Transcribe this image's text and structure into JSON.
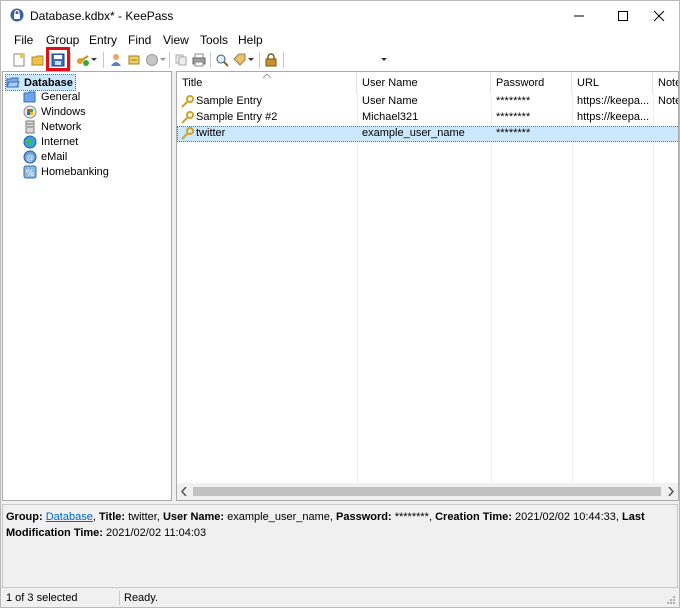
{
  "window": {
    "title": "Database.kdbx* - KeePass"
  },
  "menu": [
    "File",
    "Group",
    "Entry",
    "Find",
    "View",
    "Tools",
    "Help"
  ],
  "toolbar": {
    "icons": [
      "new-database-icon",
      "open-database-icon",
      "save-icon",
      "add-entry-icon",
      "copy-username-icon",
      "copy-password-icon",
      "open-url-icon",
      "copy-icon",
      "print-icon",
      "find-icon",
      "tag-icon",
      "lock-icon"
    ]
  },
  "tree": {
    "root": "Database",
    "groups": [
      "General",
      "Windows",
      "Network",
      "Internet",
      "eMail",
      "Homebanking"
    ]
  },
  "list": {
    "columns": [
      "Title",
      "User Name",
      "Password",
      "URL",
      "Notes"
    ],
    "rows": [
      {
        "title": "Sample Entry",
        "user": "User Name",
        "password": "********",
        "url": "https://keepa...",
        "notes": "Notes"
      },
      {
        "title": "Sample Entry #2",
        "user": "Michael321",
        "password": "********",
        "url": "https://keepa...",
        "notes": ""
      },
      {
        "title": "twitter",
        "user": "example_user_name",
        "password": "********",
        "url": "",
        "notes": ""
      }
    ],
    "selected_index": 2
  },
  "details": {
    "group_label": "Group:",
    "group_value": "Database",
    "title_label": "Title:",
    "title_value": "twitter,",
    "user_label": "User Name:",
    "user_value": "example_user_name,",
    "password_label": "Password:",
    "password_value": "********,",
    "ctime_label": "Creation Time:",
    "ctime_value": "2021/02/02 10:44:33,",
    "mtime_label": "Last Modification Time:",
    "mtime_value": "2021/02/02 11:04:03"
  },
  "status": {
    "selection": "1 of 3 selected",
    "state": "Ready."
  },
  "colors": {
    "selection_bg": "#cce8ff",
    "highlight_red": "#e0101a",
    "link": "#0066cc"
  }
}
